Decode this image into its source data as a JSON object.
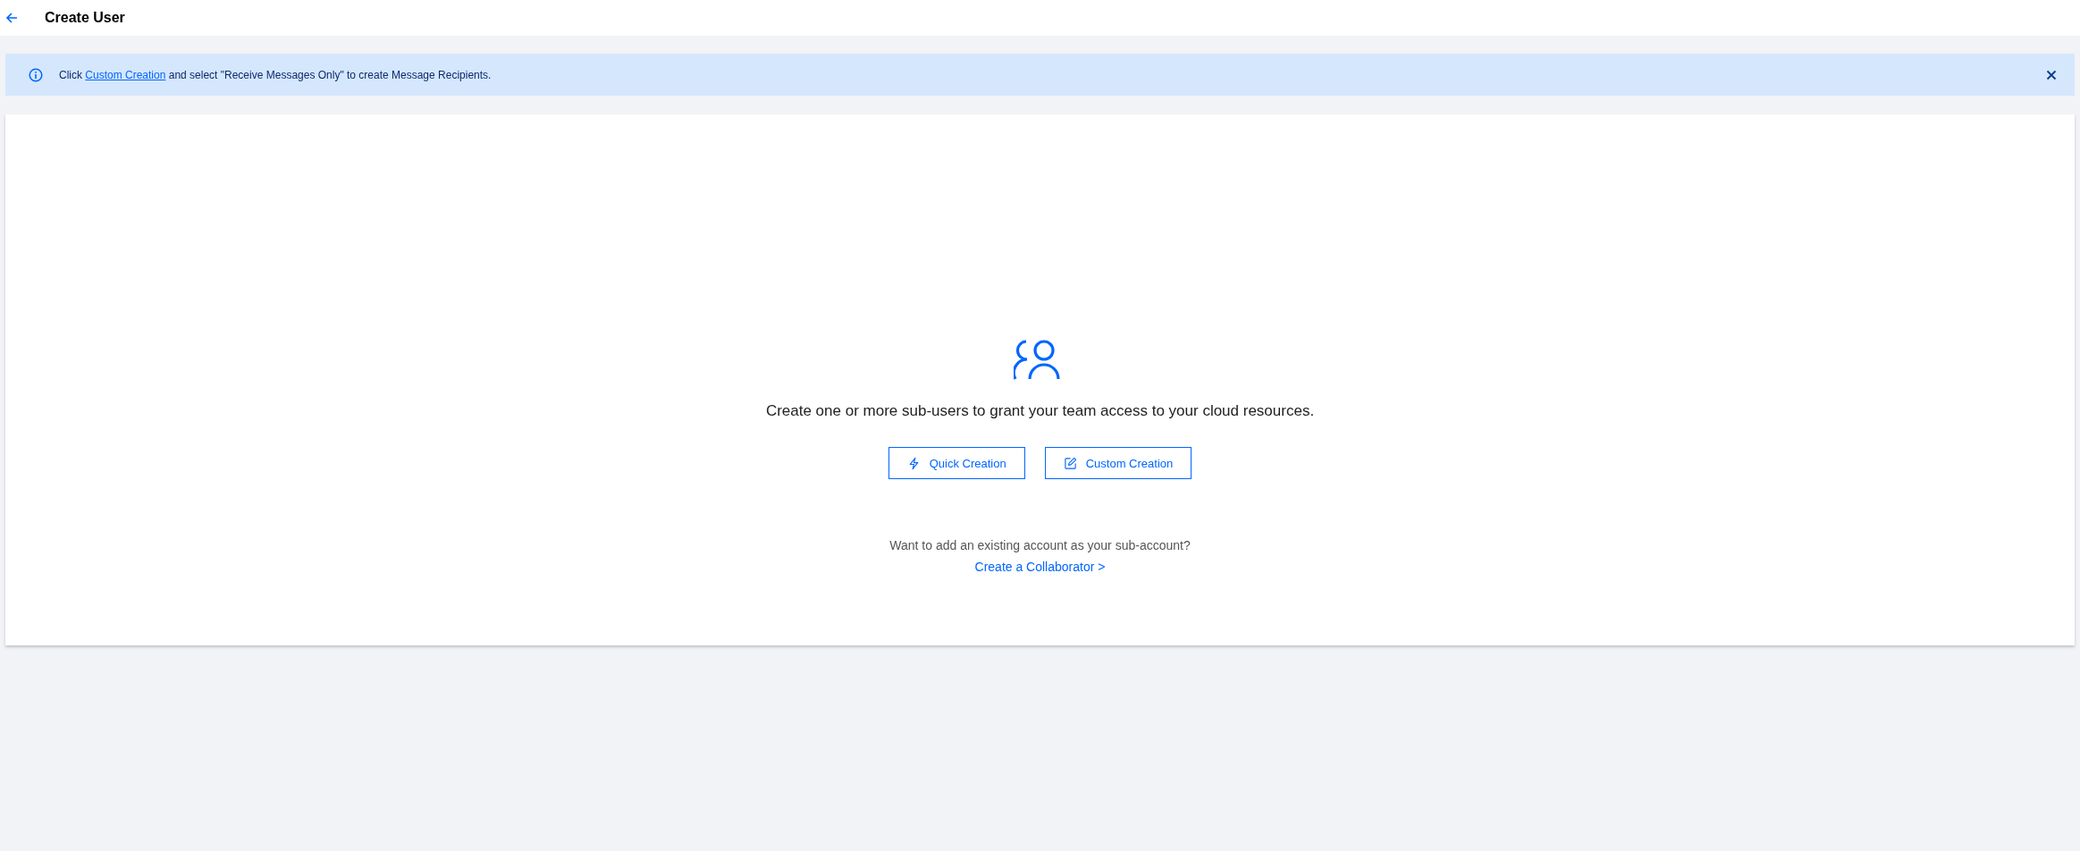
{
  "header": {
    "title": "Create User"
  },
  "notice": {
    "before": "Click ",
    "link": "Custom Creation",
    "after": " and select \"Receive Messages Only\" to create Message Recipients."
  },
  "empty_state": {
    "message": "Create one or more sub-users to grant your team access to your cloud resources.",
    "buttons": [
      {
        "kind": "quick",
        "label": "Quick Creation"
      },
      {
        "kind": "custom",
        "label": "Custom Creation"
      }
    ],
    "question": "Want to add an existing account as your sub-account?",
    "link": "Create a Collaborator >"
  }
}
